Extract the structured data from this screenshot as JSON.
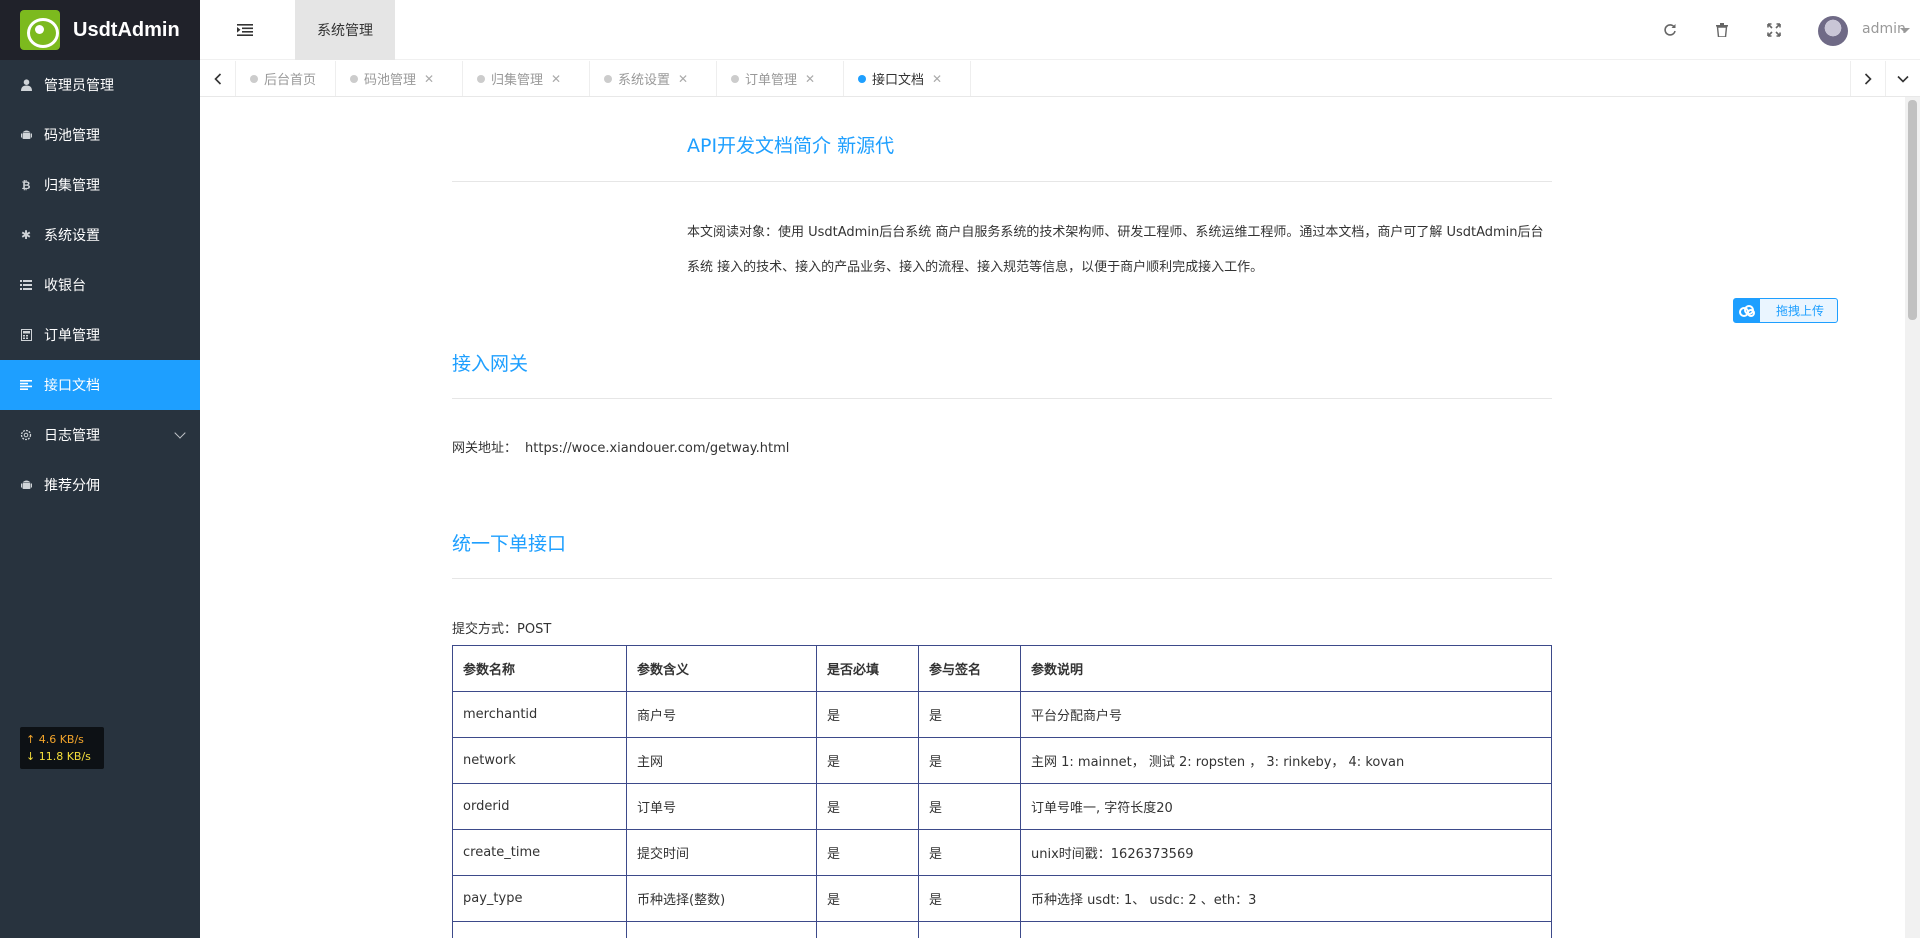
{
  "app": {
    "brand": "UsdtAdmin"
  },
  "sidebar": {
    "items": [
      {
        "label": "管理员管理",
        "icon": "user-icon"
      },
      {
        "label": "码池管理",
        "icon": "android-icon"
      },
      {
        "label": "归集管理",
        "icon": "bitcoin-icon"
      },
      {
        "label": "系统设置",
        "icon": "asterisk-icon"
      },
      {
        "label": "收银台",
        "icon": "list-icon"
      },
      {
        "label": "订单管理",
        "icon": "calculator-icon"
      },
      {
        "label": "接口文档",
        "icon": "text-align-icon",
        "active": true
      },
      {
        "label": "日志管理",
        "icon": "cog-icon",
        "has_submenu": true
      },
      {
        "label": "推荐分佣",
        "icon": "android-icon"
      }
    ],
    "netspeed": {
      "up": "↑ 4.6 KB/s",
      "down": "↓ 11.8 KB/s"
    }
  },
  "header": {
    "section_tab": "系统管理",
    "username": "admin",
    "tools": [
      "refresh-icon",
      "trash-icon",
      "fullscreen-icon"
    ]
  },
  "tabs": [
    {
      "label": "后台首页",
      "closable": false
    },
    {
      "label": "码池管理",
      "closable": true
    },
    {
      "label": "归集管理",
      "closable": true
    },
    {
      "label": "系统设置",
      "closable": true
    },
    {
      "label": "订单管理",
      "closable": true
    },
    {
      "label": "接口文档",
      "closable": true,
      "active": true
    }
  ],
  "doc": {
    "title": "API开发文档简介 新源代",
    "intro": "本文阅读对象：使用 UsdtAdmin后台系统 商户自服务系统的技术架构师、研发工程师、系统运维工程师。通过本文档，商户可了解 UsdtAdmin后台系统 接入的技术、接入的产品业务、接入的流程、接入规范等信息，以便于商户顺利完成接入工作。",
    "upload_button": "拖拽上传",
    "gateway_section": "接入网关",
    "gateway_label": "网关地址：",
    "gateway_url": "https://woce.xiandouer.com/getway.html",
    "order_section": "统一下单接口",
    "submit_method": "提交方式：POST",
    "table": {
      "headers": [
        "参数名称",
        "参数含义",
        "是否必填",
        "参与签名",
        "参数说明"
      ],
      "rows": [
        [
          "merchantid",
          "商户号",
          "是",
          "是",
          "平台分配商户号"
        ],
        [
          "network",
          "主网",
          "是",
          "是",
          "主网 1: mainnet， 测试 2: ropsten ， 3: rinkeby， 4: kovan"
        ],
        [
          "orderid",
          "订单号",
          "是",
          "是",
          "订单号唯一, 字符长度20"
        ],
        [
          "create_time",
          "提交时间",
          "是",
          "是",
          "unix时间戳：1626373569"
        ],
        [
          "pay_type",
          "币种选择(整数)",
          "是",
          "是",
          "币种选择 usdt: 1、 usdc: 2 、eth：3"
        ],
        [
          "",
          "",
          "",
          "",
          ""
        ]
      ]
    }
  }
}
